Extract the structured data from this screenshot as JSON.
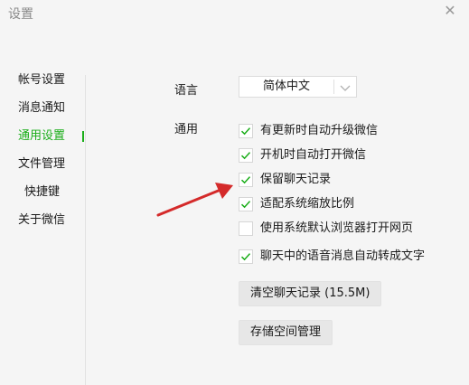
{
  "window": {
    "title": "设置",
    "close_glyph": "✕"
  },
  "sidebar": {
    "items": [
      {
        "label": "帐号设置",
        "active": false
      },
      {
        "label": "消息通知",
        "active": false
      },
      {
        "label": "通用设置",
        "active": true
      },
      {
        "label": "文件管理",
        "active": false
      },
      {
        "label": "快捷键",
        "active": false
      },
      {
        "label": "关于微信",
        "active": false
      }
    ]
  },
  "general": {
    "language_label": "语言",
    "language_value": "简体中文",
    "general_label": "通用",
    "options": [
      {
        "label": "有更新时自动升级微信",
        "checked": true
      },
      {
        "label": "开机时自动打开微信",
        "checked": true
      },
      {
        "label": "保留聊天记录",
        "checked": true
      },
      {
        "label": "适配系统缩放比例",
        "checked": true
      },
      {
        "label": "使用系统默认浏览器打开网页",
        "checked": false
      },
      {
        "label": "聊天中的语音消息自动转成文字",
        "checked": true
      }
    ],
    "clear_history_button": "清空聊天记录 (15.5M)",
    "storage_button": "存储空间管理"
  },
  "colors": {
    "accent": "#1aad19",
    "checkmark": "#1aad19",
    "annotation_arrow": "#d42a2a"
  },
  "icons": {
    "close": "close-icon",
    "dropdown": "chevron-down-icon",
    "checkmark": "checkmark-icon",
    "annotation": "red-arrow-icon"
  }
}
